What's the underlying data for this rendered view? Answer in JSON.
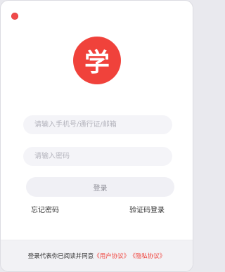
{
  "window": {
    "close_button": "close"
  },
  "logo": {
    "char": "学"
  },
  "form": {
    "phone_placeholder": "请输入手机号/通行证/邮箱",
    "password_placeholder": "请输入密码",
    "login_label": "登录"
  },
  "links": {
    "forgot_password": "忘记密码",
    "code_login": "验证码登录"
  },
  "footer": {
    "prefix": "登录代表你已阅读并同意",
    "user_agreement": "《用户协议》",
    "privacy_agreement": "《隐私协议》"
  },
  "colors": {
    "accent": "#f0423b",
    "input_bg": "#f4f4f8",
    "footer_bg": "#f2f2f5"
  }
}
